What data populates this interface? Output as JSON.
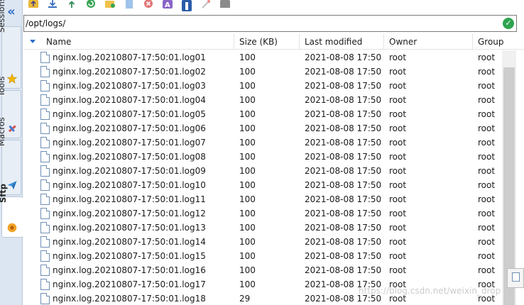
{
  "sidebar": {
    "tabs": [
      {
        "label": "Sessions",
        "icon": "star-icon"
      },
      {
        "label": "Tools",
        "icon": "tools-icon"
      },
      {
        "label": "Macros",
        "icon": "macro-icon"
      },
      {
        "label": "Sftp",
        "icon": "sftp-icon",
        "active": true
      }
    ]
  },
  "toolbar": {
    "icons": [
      "parent-folder-icon",
      "download-icon",
      "upload-icon",
      "refresh-icon",
      "new-folder-icon",
      "new-file-icon",
      "delete-icon",
      "rename-icon",
      "properties-icon",
      "wand-icon",
      "terminal-icon"
    ]
  },
  "path": {
    "value": "/opt/logs/"
  },
  "table": {
    "columns": [
      "Name",
      "Size (KB)",
      "Last modified",
      "Owner",
      "Group"
    ],
    "rows": [
      {
        "name": "nginx.log.20210807-17:50:01.log01",
        "size": "100",
        "modified": "2021-08-08 17:50",
        "owner": "root",
        "group": "root"
      },
      {
        "name": "nginx.log.20210807-17:50:01.log02",
        "size": "100",
        "modified": "2021-08-08 17:50",
        "owner": "root",
        "group": "root"
      },
      {
        "name": "nginx.log.20210807-17:50:01.log03",
        "size": "100",
        "modified": "2021-08-08 17:50",
        "owner": "root",
        "group": "root"
      },
      {
        "name": "nginx.log.20210807-17:50:01.log04",
        "size": "100",
        "modified": "2021-08-08 17:50",
        "owner": "root",
        "group": "root"
      },
      {
        "name": "nginx.log.20210807-17:50:01.log05",
        "size": "100",
        "modified": "2021-08-08 17:50",
        "owner": "root",
        "group": "root"
      },
      {
        "name": "nginx.log.20210807-17:50:01.log06",
        "size": "100",
        "modified": "2021-08-08 17:50",
        "owner": "root",
        "group": "root"
      },
      {
        "name": "nginx.log.20210807-17:50:01.log07",
        "size": "100",
        "modified": "2021-08-08 17:50",
        "owner": "root",
        "group": "root"
      },
      {
        "name": "nginx.log.20210807-17:50:01.log08",
        "size": "100",
        "modified": "2021-08-08 17:50",
        "owner": "root",
        "group": "root"
      },
      {
        "name": "nginx.log.20210807-17:50:01.log09",
        "size": "100",
        "modified": "2021-08-08 17:50",
        "owner": "root",
        "group": "root"
      },
      {
        "name": "nginx.log.20210807-17:50:01.log10",
        "size": "100",
        "modified": "2021-08-08 17:50",
        "owner": "root",
        "group": "root"
      },
      {
        "name": "nginx.log.20210807-17:50:01.log11",
        "size": "100",
        "modified": "2021-08-08 17:50",
        "owner": "root",
        "group": "root"
      },
      {
        "name": "nginx.log.20210807-17:50:01.log12",
        "size": "100",
        "modified": "2021-08-08 17:50",
        "owner": "root",
        "group": "root"
      },
      {
        "name": "nginx.log.20210807-17:50:01.log13",
        "size": "100",
        "modified": "2021-08-08 17:50",
        "owner": "root",
        "group": "root"
      },
      {
        "name": "nginx.log.20210807-17:50:01.log14",
        "size": "100",
        "modified": "2021-08-08 17:50",
        "owner": "root",
        "group": "root"
      },
      {
        "name": "nginx.log.20210807-17:50:01.log15",
        "size": "100",
        "modified": "2021-08-08 17:50",
        "owner": "root",
        "group": "root"
      },
      {
        "name": "nginx.log.20210807-17:50:01.log16",
        "size": "100",
        "modified": "2021-08-08 17:50",
        "owner": "root",
        "group": "root"
      },
      {
        "name": "nginx.log.20210807-17:50:01.log17",
        "size": "100",
        "modified": "2021-08-08 17:50",
        "owner": "root",
        "group": "root"
      },
      {
        "name": "nginx.log.20210807-17:50:01.log18",
        "size": "29",
        "modified": "2021-08-08 17:50",
        "owner": "root",
        "group": "root"
      }
    ]
  },
  "watermark": "https://blog.csdn.net/weixin_drop"
}
